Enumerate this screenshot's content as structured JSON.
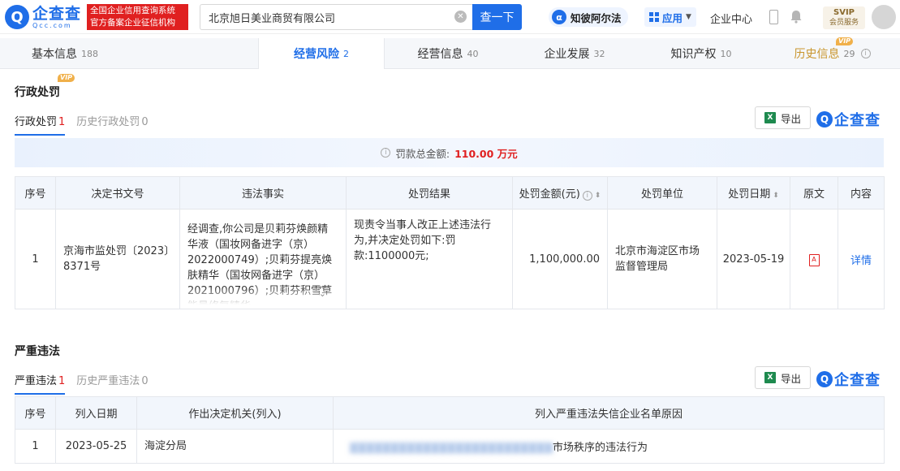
{
  "header": {
    "logo_mark": "Q",
    "logo_name": "企查查",
    "logo_domain": "Qcc.com",
    "red_line1": "全国企业信用查询系统",
    "red_line2": "官方备案企业征信机构",
    "search_value": "北京旭日美业商贸有限公司",
    "search_button": "查一下",
    "zhibo_label": "知彼阿尔法",
    "apps_label": "应用",
    "center_link": "企业中心",
    "svip_title": "SVIP",
    "svip_sub": "会员服务"
  },
  "tabs": [
    {
      "label": "基本信息",
      "count": "188"
    },
    {
      "label": "经营风险",
      "count": "2"
    },
    {
      "label": "经营信息",
      "count": "40"
    },
    {
      "label": "企业发展",
      "count": "32"
    },
    {
      "label": "知识产权",
      "count": "10"
    },
    {
      "label": "历史信息",
      "count": "29"
    }
  ],
  "vip_label": "VIP",
  "admin_penalty": {
    "title": "行政处罚",
    "subtab_current": "行政处罚",
    "subtab_current_count": "1",
    "subtab_history": "历史行政处罚",
    "subtab_history_count": "0",
    "export_label": "导出",
    "watermark": "企查查",
    "fine_label": "罚款总金额:",
    "fine_amount": "110.00 万元",
    "columns": [
      "序号",
      "决定书文号",
      "违法事实",
      "处罚结果",
      "处罚金额(元)",
      "处罚单位",
      "处罚日期",
      "原文",
      "内容"
    ],
    "row": {
      "index": "1",
      "doc_no": "京海市监处罚〔2023〕8371号",
      "facts": "经调查,你公司是贝莉芬焕颜精华液（国妆网备进字（京）2022000749）;贝莉芬提亮焕肤精华（国妆网备进字（京）2021000796）;贝莉芬积雪草能量修复精华",
      "result": "现责令当事人改正上述违法行为,并决定处罚如下:罚款:1100000元;",
      "amount": "1,100,000.00",
      "unit": "北京市海淀区市场监督管理局",
      "date": "2023-05-19",
      "detail": "详情"
    }
  },
  "serious_violation": {
    "title": "严重违法",
    "subtab_current": "严重违法",
    "subtab_current_count": "1",
    "subtab_history": "历史严重违法",
    "subtab_history_count": "0",
    "export_label": "导出",
    "watermark": "企查查",
    "columns": [
      "序号",
      "列入日期",
      "作出决定机关(列入)",
      "列入严重违法失信企业名单原因"
    ],
    "row": {
      "index": "1",
      "date": "2023-05-25",
      "authority": "海淀分局",
      "reason_visible": "市场秩序的违法行为"
    }
  }
}
